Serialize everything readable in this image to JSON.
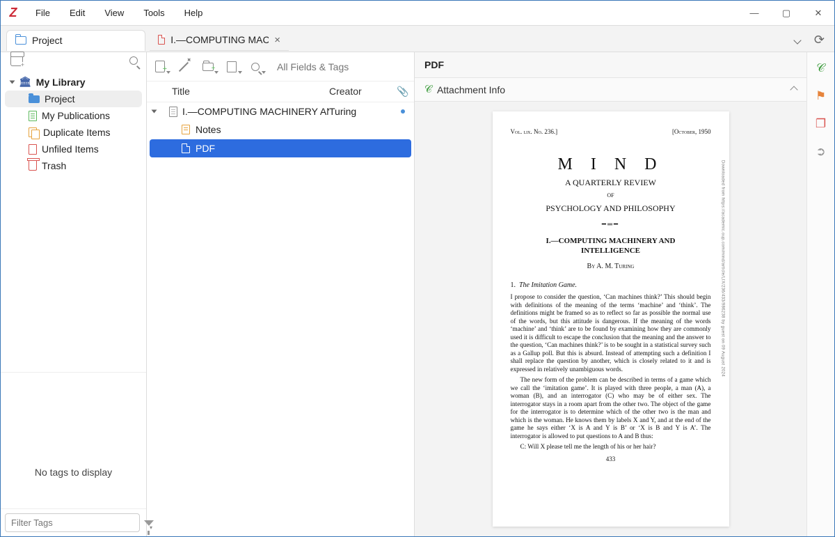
{
  "menus": {
    "file": "File",
    "edit": "Edit",
    "view": "View",
    "tools": "Tools",
    "help": "Help"
  },
  "tabs": {
    "collection": "Project",
    "pdf": "I.—COMPUTING MACHINI"
  },
  "sidebar": {
    "library": "My Library",
    "items": [
      "Project",
      "My Publications",
      "Duplicate Items",
      "Unfiled Items",
      "Trash"
    ],
    "no_tags": "No tags to display",
    "filter_ph": "Filter Tags"
  },
  "toolbar": {
    "search_ph": "All Fields & Tags"
  },
  "list": {
    "cols": {
      "title": "Title",
      "creator": "Creator"
    },
    "item": {
      "title": "I.—COMPUTING MACHINERY AND...",
      "creator": "Turing"
    },
    "children": [
      "Notes",
      "PDF"
    ]
  },
  "details": {
    "title": "PDF",
    "section": "Attachment Info"
  },
  "pdf": {
    "runhead_l": "Vol. lix. No. 236.]",
    "runhead_r": "[October, 1950",
    "h1": "M I N D",
    "sub": "A QUARTERLY REVIEW",
    "of": "OF",
    "psy": "PSYCHOLOGY AND PHILOSOPHY",
    "art1": "I.—COMPUTING MACHINERY AND",
    "art2": "INTELLIGENCE",
    "auth": "By A. M. Turing",
    "sec_n": "1.",
    "sec_t": "The Imitation Game.",
    "p1": "I propose to consider the question, ‘Can machines think?’ This should begin with definitions of the meaning of the terms ‘machine’ and ‘think’. The definitions might be framed so as to reflect so far as possible the normal use of the words, but this attitude is dangerous. If the meaning of the words ‘machine’ and ‘think’ are to be found by examining how they are commonly used it is difficult to escape the conclusion that the meaning and the answer to the question, ‘Can machines think?’ is to be sought in a statistical survey such as a Gallup poll. But this is absurd. Instead of attempting such a definition I shall replace the question by another, which is closely related to it and is expressed in relatively unambiguous words.",
    "p2": "The new form of the problem can be described in terms of a game which we call the ‘imitation game’. It is played with three people, a man (A), a woman (B), and an interrogator (C) who may be of either sex. The interrogator stays in a room apart from the other two. The object of the game for the interrogator is to determine which of the other two is the man and which is the woman. He knows them by labels X and Y, and at the end of the game he says either ‘X is A and Y is B’ or ‘X is B and Y is A’. The interrogator is allowed to put questions to A and B thus:",
    "p3": "C: Will X please tell me the length of his or her hair?",
    "pgnum": "433",
    "dl": "Downloaded from https://academic.oup.com/mind/article/LIX/236/433/986238 by guest on 09 August 2024"
  }
}
